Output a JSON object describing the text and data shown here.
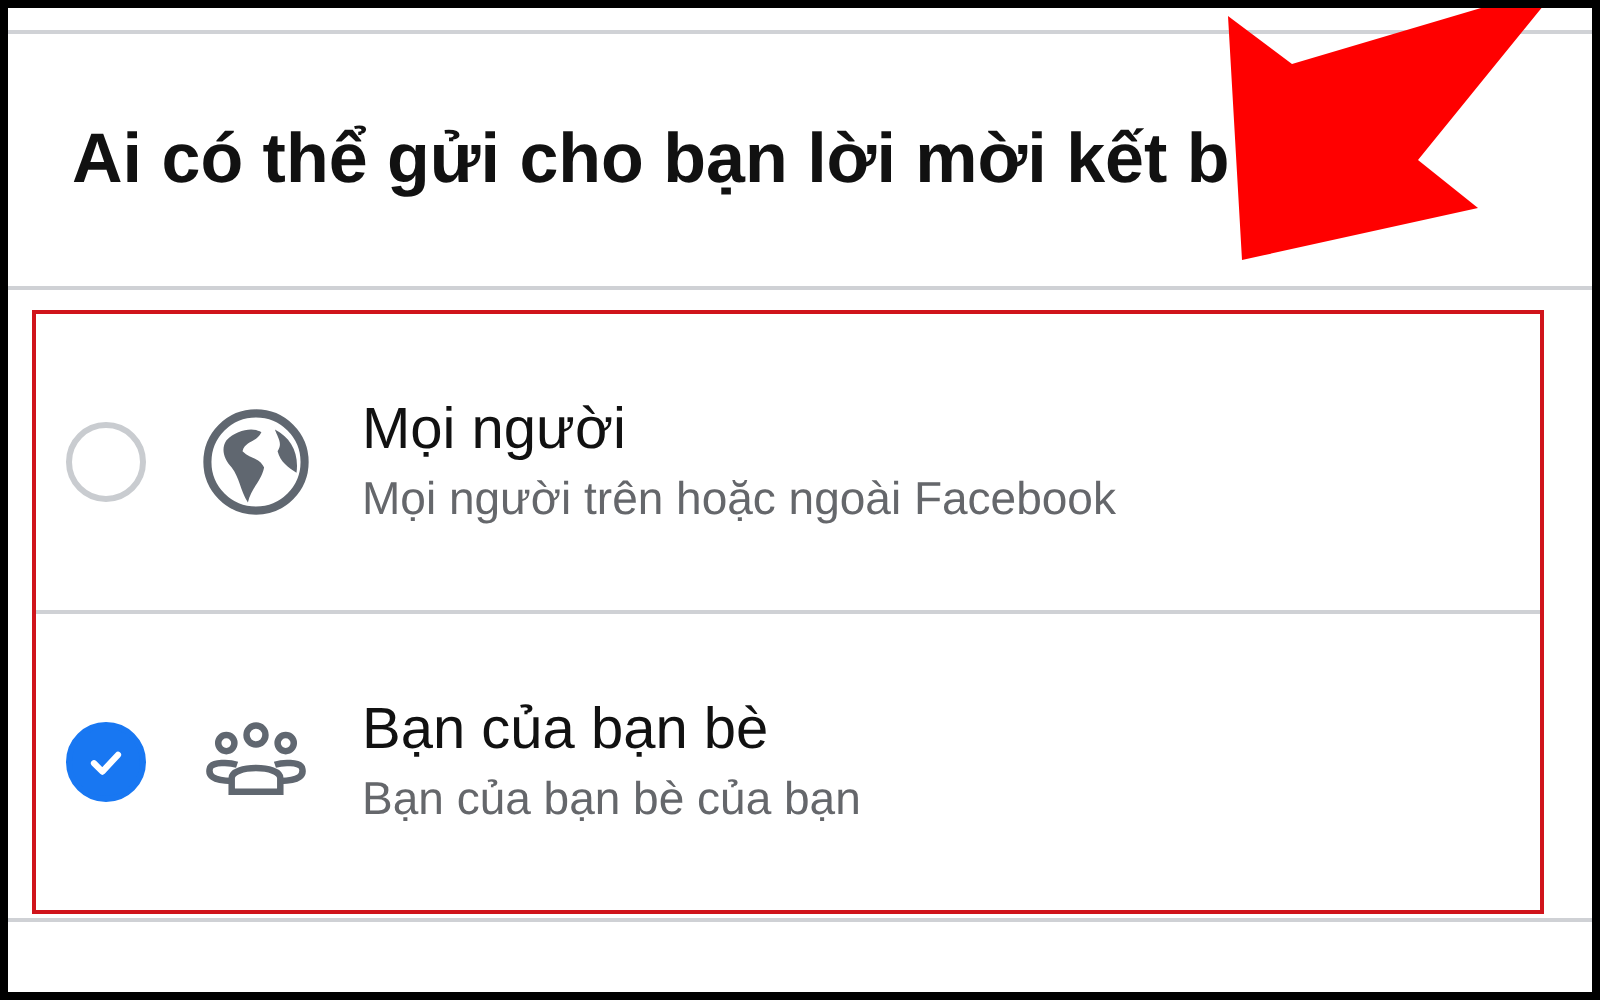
{
  "heading": "Ai có thể gửi cho bạn lời mời kết b",
  "options": [
    {
      "title": "Mọi người",
      "description": "Mọi người trên hoặc ngoài Facebook",
      "kind": "globe",
      "selected": false
    },
    {
      "title": "Bạn của bạn bè",
      "description": "Bạn của bạn bè của bạn",
      "kind": "people",
      "selected": true
    }
  ]
}
